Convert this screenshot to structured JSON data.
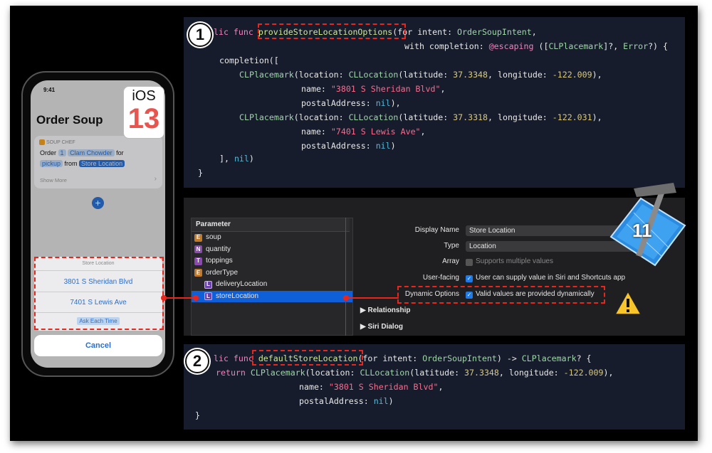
{
  "code_top": {
    "badge": "1",
    "lines": [
      "lic func provideStoreLocationOptions(for intent: OrderSoupIntent,",
      "                                     with completion: @escaping ([CLPlacemark]?, Error?) {",
      "    completion([",
      "        CLPlacemark(location: CLLocation(latitude: 37.3348, longitude: -122.009),",
      "                    name: \"3801 S Sheridan Blvd\",",
      "                    postalAddress: nil),",
      "        CLPlacemark(location: CLLocation(latitude: 37.3318, longitude: -122.031),",
      "                    name: \"7401 S Lewis Ave\",",
      "                    postalAddress: nil)",
      "    ], nil)",
      "}"
    ],
    "highlight_label": "provideStoreLocationOptions"
  },
  "code_bottom": {
    "badge": "2",
    "lines": [
      "lic func defaultStoreLocation(for intent: OrderSoupIntent) -> CLPlacemark? {",
      "    return CLPlacemark(location: CLLocation(latitude: 37.3348, longitude: -122.009),",
      "                       name: \"3801 S Sheridan Blvd\",",
      "                       postalAddress: nil)",
      "}"
    ],
    "highlight_label": "defaultStoreLocation"
  },
  "xcode": {
    "parameter_header": "Parameter",
    "parameters": [
      {
        "icon": "E",
        "label": "soup",
        "indent": 0,
        "selected": false
      },
      {
        "icon": "N",
        "label": "quantity",
        "indent": 0,
        "selected": false
      },
      {
        "icon": "T",
        "label": "toppings",
        "indent": 0,
        "selected": false
      },
      {
        "icon": "E",
        "label": "orderType",
        "indent": 0,
        "selected": false
      },
      {
        "icon": "L",
        "label": "deliveryLocation",
        "indent": 1,
        "selected": false
      },
      {
        "icon": "L",
        "label": "storeLocation",
        "indent": 1,
        "selected": true
      }
    ],
    "display_name_label": "Display Name",
    "display_name_value": "Store Location",
    "type_label": "Type",
    "type_value": "Location",
    "array_label": "Array",
    "array_value": "Supports multiple values",
    "user_facing_label": "User-facing",
    "user_facing_value": "User can supply value in Siri and Shortcuts app",
    "dynamic_options_label": "Dynamic Options",
    "dynamic_options_value": "Valid values are provided dynamically",
    "relationship_label": "Relationship",
    "siri_dialog_label": "Siri Dialog",
    "xcode_version": "11"
  },
  "phone": {
    "time": "9:41",
    "title": "Order Soup",
    "app_name": "SOUP CHEF",
    "order_word": "Order",
    "quantity": "1",
    "soup": "Clam Chowder",
    "for_word": "for",
    "order_type": "pickup",
    "from_word": "from",
    "store_location": "Store Location",
    "show_more": "Show More",
    "sheet_title": "Store Location",
    "option_1": "3801 S Sheridan Blvd",
    "option_2": "7401 S Lewis Ave",
    "option_3": "Ask Each Time",
    "cancel": "Cancel",
    "ios_label": "iOS",
    "ios_version": "13"
  }
}
